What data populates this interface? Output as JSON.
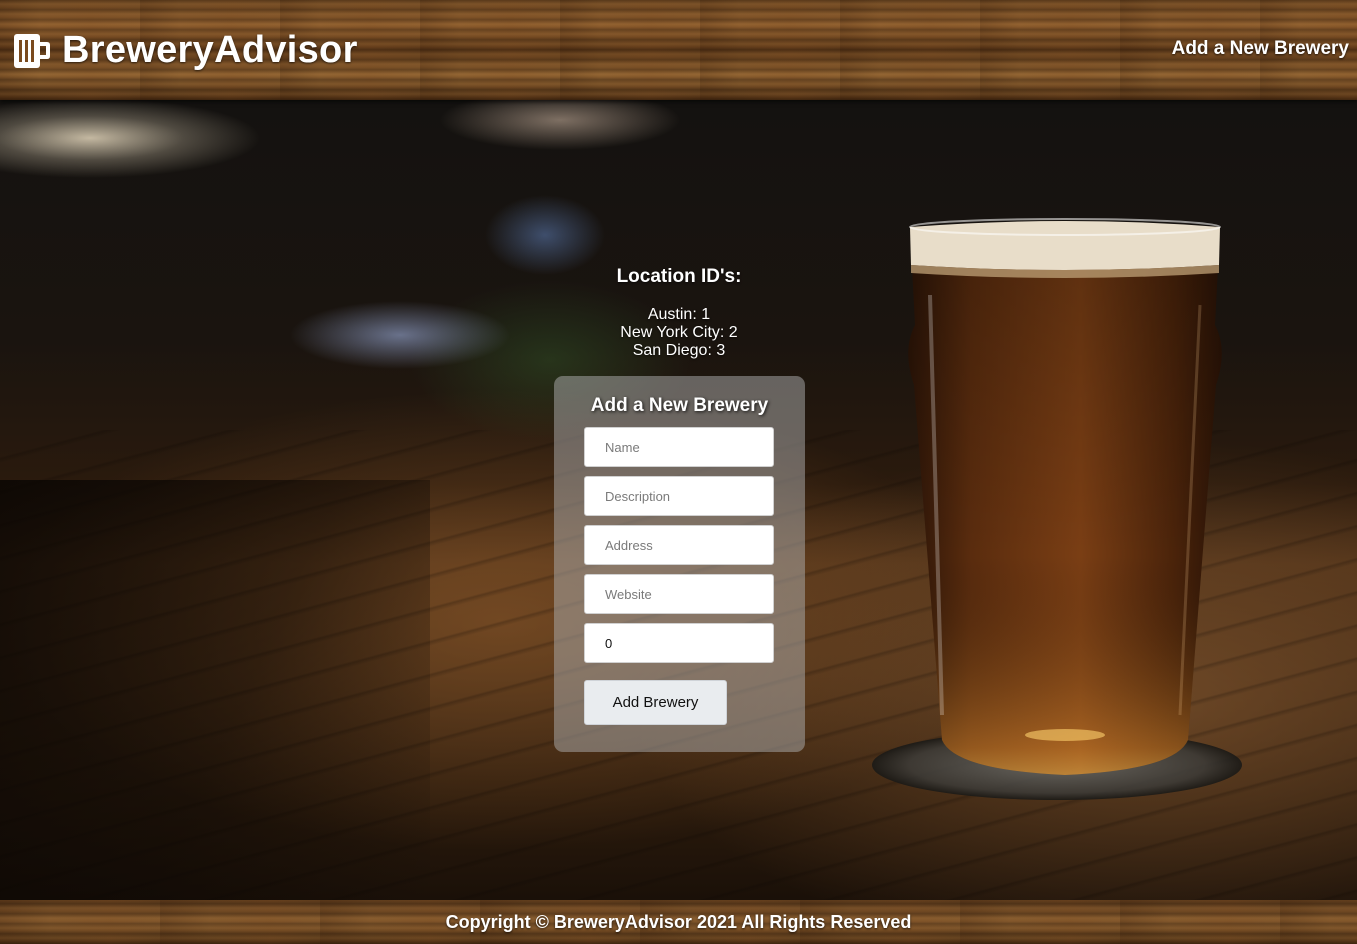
{
  "header": {
    "brand": "BreweryAdvisor",
    "brand_icon": "beer-mug-icon",
    "nav_link": "Add a New Brewery"
  },
  "locations": {
    "title": "Location ID's:",
    "items": [
      "Austin: 1",
      "New York City: 2",
      "San Diego: 3"
    ]
  },
  "form": {
    "title": "Add a New Brewery",
    "fields": {
      "name": {
        "placeholder": "Name",
        "value": ""
      },
      "description": {
        "placeholder": "Description",
        "value": ""
      },
      "address": {
        "placeholder": "Address",
        "value": ""
      },
      "website": {
        "placeholder": "Website",
        "value": ""
      },
      "location_id": {
        "placeholder": "",
        "value": "0"
      }
    },
    "submit_label": "Add Brewery"
  },
  "footer": {
    "copyright": "Copyright © BreweryAdvisor 2021 All Rights Reserved"
  },
  "colors": {
    "text": "#ffffff",
    "form_card": "rgba(170,170,170,0.52)",
    "button_bg": "#e9ecef"
  }
}
